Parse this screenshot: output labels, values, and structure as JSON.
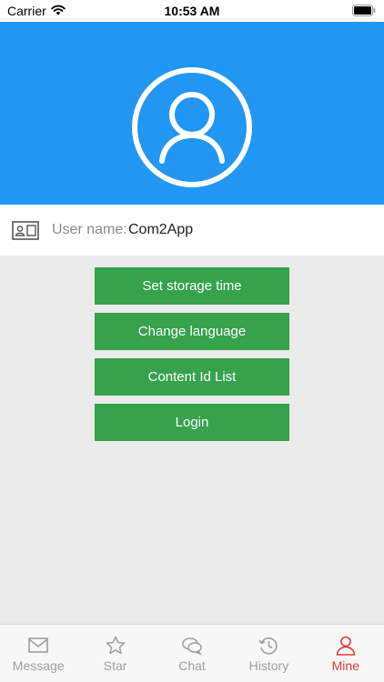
{
  "status_bar": {
    "carrier": "Carrier",
    "time": "10:53 AM"
  },
  "profile": {
    "icon": "user-avatar-icon",
    "user_name_label": "User name:",
    "user_name_value": "Com2App",
    "id_card_icon": "id-card-icon"
  },
  "actions": [
    {
      "label": "Set storage time"
    },
    {
      "label": "Change language"
    },
    {
      "label": "Content Id List"
    },
    {
      "label": "Login"
    }
  ],
  "tabbar": {
    "tabs": [
      {
        "label": "Message",
        "icon": "envelope-icon",
        "active": false
      },
      {
        "label": "Star",
        "icon": "star-icon",
        "active": false
      },
      {
        "label": "Chat",
        "icon": "chat-bubbles-icon",
        "active": false
      },
      {
        "label": "History",
        "icon": "history-clock-icon",
        "active": false
      },
      {
        "label": "Mine",
        "icon": "person-icon",
        "active": true
      }
    ]
  },
  "colors": {
    "header": "#2196f3",
    "button": "#36a24b",
    "active_tab": "#e53935",
    "background": "#ebebeb"
  }
}
